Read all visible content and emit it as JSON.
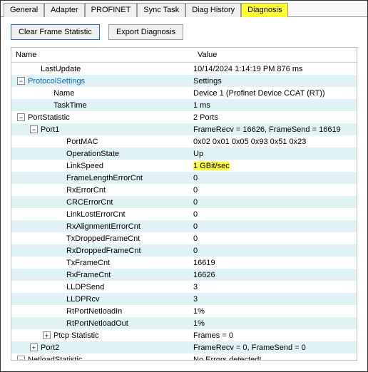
{
  "tabs": {
    "general": "General",
    "adapter": "Adapter",
    "profinet": "PROFINET",
    "synctask": "Sync Task",
    "diaghistory": "Diag History",
    "diagnosis": "Diagnosis"
  },
  "buttons": {
    "clear": "Clear Frame Statistic",
    "export": "Export Diagnosis"
  },
  "headers": {
    "name": "Name",
    "value": "Value"
  },
  "rows": [
    {
      "depth": 1,
      "exp": null,
      "alt": false,
      "name": "LastUpdate",
      "value": "10/14/2024 1:14:19 PM 876 ms"
    },
    {
      "depth": 0,
      "exp": "-",
      "alt": true,
      "name": "ProtocolSettings",
      "value": "Settings",
      "nameColor": "#0066cc"
    },
    {
      "depth": 2,
      "exp": null,
      "alt": false,
      "name": "Name",
      "value": "Device 1 (Profinet Device CCAT (RT))"
    },
    {
      "depth": 2,
      "exp": null,
      "alt": true,
      "name": "TaskTime",
      "value": "1 ms"
    },
    {
      "depth": 0,
      "exp": "-",
      "alt": false,
      "name": "PortStatistic",
      "value": "2 Ports"
    },
    {
      "depth": 1,
      "exp": "-",
      "alt": true,
      "name": "Port1",
      "value": "FrameRecv = 16626, FrameSend = 16619"
    },
    {
      "depth": 3,
      "exp": null,
      "alt": false,
      "name": "PortMAC",
      "value": "0x02 0x01 0x05 0x93 0x51 0x23"
    },
    {
      "depth": 3,
      "exp": null,
      "alt": true,
      "name": "OperationState",
      "value": "Up"
    },
    {
      "depth": 3,
      "exp": null,
      "alt": false,
      "name": "LinkSpeed",
      "value": "1 GBit/sec",
      "hlValue": true
    },
    {
      "depth": 3,
      "exp": null,
      "alt": true,
      "name": "FrameLengthErrorCnt",
      "value": "0"
    },
    {
      "depth": 3,
      "exp": null,
      "alt": false,
      "name": "RxErrorCnt",
      "value": "0"
    },
    {
      "depth": 3,
      "exp": null,
      "alt": true,
      "name": "CRCErrorCnt",
      "value": "0"
    },
    {
      "depth": 3,
      "exp": null,
      "alt": false,
      "name": "LinkLostErrorCnt",
      "value": "0"
    },
    {
      "depth": 3,
      "exp": null,
      "alt": true,
      "name": "RxAlignmentErrorCnt",
      "value": "0"
    },
    {
      "depth": 3,
      "exp": null,
      "alt": false,
      "name": "TxDroppedFrameCnt",
      "value": "0"
    },
    {
      "depth": 3,
      "exp": null,
      "alt": true,
      "name": "RxDroppedFrameCnt",
      "value": "0"
    },
    {
      "depth": 3,
      "exp": null,
      "alt": false,
      "name": "TxFrameCnt",
      "value": "16619"
    },
    {
      "depth": 3,
      "exp": null,
      "alt": true,
      "name": "RxFrameCnt",
      "value": "16626"
    },
    {
      "depth": 3,
      "exp": null,
      "alt": false,
      "name": "LLDPSend",
      "value": "3"
    },
    {
      "depth": 3,
      "exp": null,
      "alt": true,
      "name": "LLDPRcv",
      "value": "3"
    },
    {
      "depth": 3,
      "exp": null,
      "alt": false,
      "name": "RtPortNetloadIn",
      "value": "1%"
    },
    {
      "depth": 3,
      "exp": null,
      "alt": true,
      "name": "RtPortNetloadOut",
      "value": "1%"
    },
    {
      "depth": 2,
      "exp": "+",
      "alt": false,
      "name": "Ptcp Statistic",
      "value": "Frames = 0"
    },
    {
      "depth": 1,
      "exp": "+",
      "alt": true,
      "name": "Port2",
      "value": "FrameRecv = 0, FrameSend = 0"
    },
    {
      "depth": 0,
      "exp": "-",
      "alt": false,
      "name": "NetloadStatistic",
      "value": "No Errors detected!"
    }
  ]
}
